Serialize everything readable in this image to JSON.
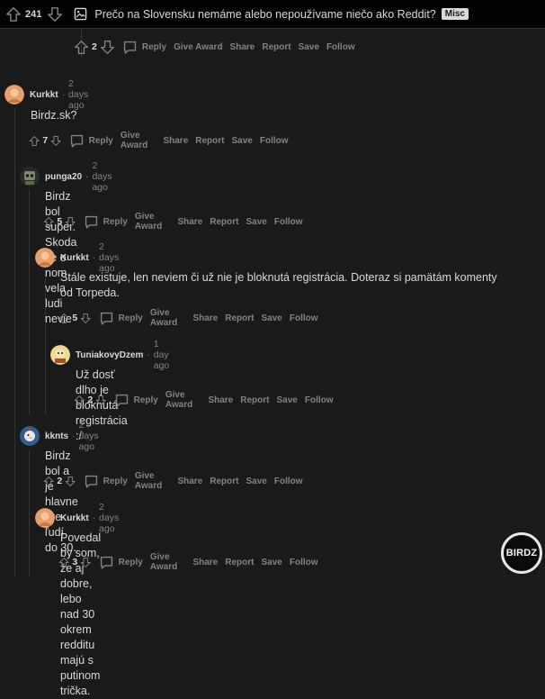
{
  "post": {
    "score": "241",
    "title": "Prečo na Slovensku nemáme alebo nepoužívame niečo ako Reddit?",
    "flair": "Misc"
  },
  "action_labels": {
    "reply": "Reply",
    "give_award": "Give Award",
    "share": "Share",
    "report": "Report",
    "save": "Save",
    "follow": "Follow"
  },
  "prev_comment": {
    "score": "2"
  },
  "comments": [
    {
      "author": "Kurkkt",
      "time": "2 days ago",
      "text": "Birdz.sk?",
      "score": "7"
    },
    {
      "author": "punga20",
      "time": "2 days ago",
      "text": "Birdz bol super. Skoda ze o nom vela ludi nevie",
      "score": "5"
    },
    {
      "author": "Kurkkt",
      "time": "2 days ago",
      "text": "Stále existuje, len neviem či už nie je bloknutá registrácia. Doteraz si pamätám komenty od Torpeda.",
      "score": "5"
    },
    {
      "author": "TuniakovyDzem",
      "time": "1 day ago",
      "text": "Už dosť dlho je bloknutá registrácia :/",
      "score": "2"
    },
    {
      "author": "kknts",
      "time": "2 days ago",
      "text": "Birdz bol a je hlavne pre ľudí do 30.",
      "score": "2"
    },
    {
      "author": "Kurkkt",
      "time": "2 days ago",
      "text": "Povedal by som, že aj dobre, lebo nad 30 okrem redditu majú s putinom trička.",
      "score": "3"
    }
  ],
  "watermark": "BIRDZ",
  "colors": {
    "background": "#1a1a1b",
    "text": "#d7dadc",
    "meta": "#818384",
    "thread_line": "#343536"
  }
}
